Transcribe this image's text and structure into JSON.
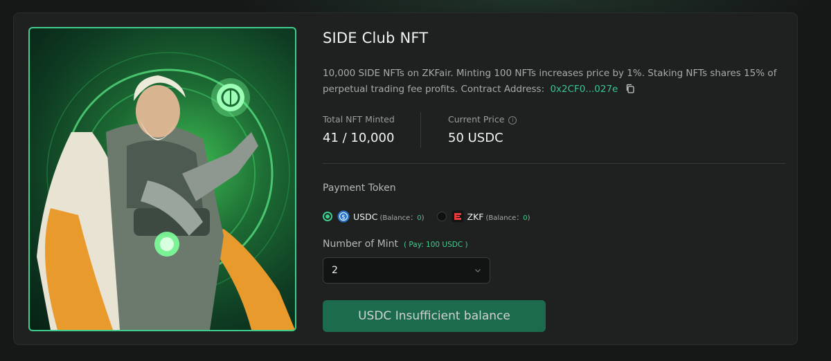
{
  "nft": {
    "title": "SIDE Club NFT",
    "description": "10,000 SIDE NFTs on ZKFair. Minting 100 NFTs increases price by 1%. Staking NFTs shares 15% of perpetual trading fee profits. Contract Address:",
    "contract_address": "0x2CF0...027e"
  },
  "stats": {
    "minted_label": "Total NFT Minted",
    "minted_value": "41 / 10,000",
    "price_label": "Current Price",
    "price_value": "50 USDC"
  },
  "payment": {
    "label": "Payment Token",
    "options": [
      {
        "name": "USDC",
        "balance_prefix": "(Balance：",
        "balance_value": "0",
        "balance_suffix": ")",
        "selected": true
      },
      {
        "name": "ZKF",
        "balance_prefix": "(Balance：",
        "balance_value": "0",
        "balance_suffix": ")",
        "selected": false
      }
    ]
  },
  "mint": {
    "label": "Number of Mint",
    "pay_note": "( Pay: 100 USDC )",
    "selected": "2"
  },
  "action": {
    "button_label": "USDC Insufficient balance"
  },
  "icons": {
    "copy": "copy-icon",
    "info": "info-icon",
    "chevron": "chevron-down-icon"
  },
  "colors": {
    "accent": "#3ecf8e",
    "button": "#1d6b4d",
    "card": "#1f2121"
  }
}
